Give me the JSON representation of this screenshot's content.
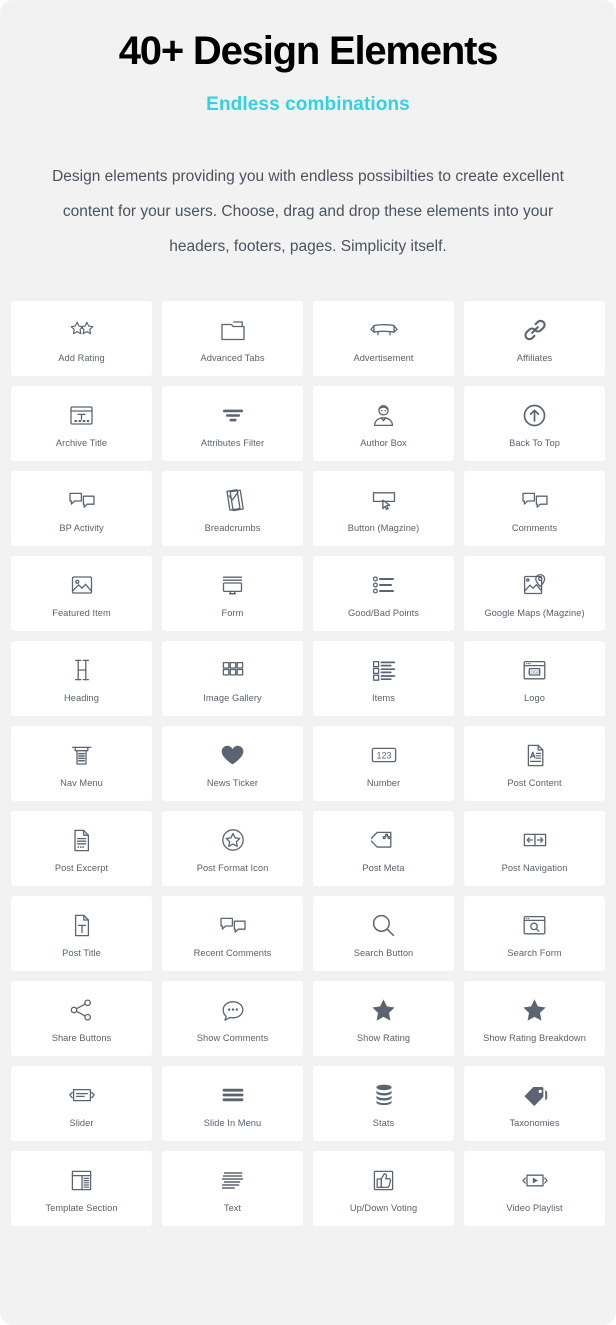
{
  "header": {
    "title": "40+ Design Elements",
    "subtitle": "Endless combinations",
    "subtitle_color": "#2fd3e1",
    "intro": "Design elements providing you with endless possibilties to create excellent content for your users. Choose, drag and drop these elements into your headers, footers, pages. Simplicity itself."
  },
  "colors": {
    "background": "#f2f2f2",
    "card": "#ffffff",
    "icon": "#5b6470",
    "label": "#59626e",
    "accent": "#2fd3e1",
    "title": "#000000"
  },
  "grid": {
    "columns": 4,
    "items": [
      {
        "label": "Add Rating",
        "icon": "two-stars-outline-icon"
      },
      {
        "label": "Advanced Tabs",
        "icon": "folder-tabs-icon"
      },
      {
        "label": "Advertisement",
        "icon": "billboard-banner-icon"
      },
      {
        "label": "Affiliates",
        "icon": "chain-link-icon"
      },
      {
        "label": "Archive Title",
        "icon": "browser-title-t-icon"
      },
      {
        "label": "Attributes Filter",
        "icon": "filter-funnel-bars-icon"
      },
      {
        "label": "Author Box",
        "icon": "author-person-icon"
      },
      {
        "label": "Back To Top",
        "icon": "circle-arrow-up-icon"
      },
      {
        "label": "BP Activity",
        "icon": "two-speech-bubbles-icon"
      },
      {
        "label": "Breadcrumbs",
        "icon": "checkmark-pages-icon"
      },
      {
        "label": "Button (Magzine)",
        "icon": "button-cursor-icon"
      },
      {
        "label": "Comments",
        "icon": "two-speech-bubbles-icon"
      },
      {
        "label": "Featured Item",
        "icon": "image-picture-icon"
      },
      {
        "label": "Form",
        "icon": "form-monitor-icon"
      },
      {
        "label": "Good/Bad Points",
        "icon": "bullet-list-circles-icon"
      },
      {
        "label": "Google Maps (Magzine)",
        "icon": "map-pin-icon"
      },
      {
        "label": "Heading",
        "icon": "letter-h-serif-icon"
      },
      {
        "label": "Image Gallery",
        "icon": "grid-squares-icon"
      },
      {
        "label": "Items",
        "icon": "list-items-icon"
      },
      {
        "label": "Logo",
        "icon": "browser-logo-icon"
      },
      {
        "label": "Nav Menu",
        "icon": "nav-menu-icon"
      },
      {
        "label": "News Ticker",
        "icon": "heart-filled-icon"
      },
      {
        "label": "Number",
        "icon": "number-123-icon"
      },
      {
        "label": "Post Content",
        "icon": "document-a-lines-icon"
      },
      {
        "label": "Post Excerpt",
        "icon": "document-excerpt-icon"
      },
      {
        "label": "Post Format Icon",
        "icon": "circle-star-icon"
      },
      {
        "label": "Post Meta",
        "icon": "price-tag-icon"
      },
      {
        "label": "Post Navigation",
        "icon": "left-right-arrows-box-icon"
      },
      {
        "label": "Post Title",
        "icon": "document-t-icon"
      },
      {
        "label": "Recent Comments",
        "icon": "two-speech-bubbles-icon"
      },
      {
        "label": "Search Button",
        "icon": "magnifier-icon"
      },
      {
        "label": "Search Form",
        "icon": "browser-search-icon"
      },
      {
        "label": "Share Buttons",
        "icon": "share-nodes-icon"
      },
      {
        "label": "Show Comments",
        "icon": "speech-bubble-dots-icon"
      },
      {
        "label": "Show Rating",
        "icon": "star-filled-icon"
      },
      {
        "label": "Show Rating Breakdown",
        "icon": "star-filled-icon"
      },
      {
        "label": "Slider",
        "icon": "slider-arrows-icon"
      },
      {
        "label": "Slide In Menu",
        "icon": "hamburger-bars-icon"
      },
      {
        "label": "Stats",
        "icon": "database-stack-icon"
      },
      {
        "label": "Taxonomies",
        "icon": "tags-filled-icon"
      },
      {
        "label": "Template Section",
        "icon": "template-layout-icon"
      },
      {
        "label": "Text",
        "icon": "text-lines-icon"
      },
      {
        "label": "Up/Down Voting",
        "icon": "thumbs-up-box-icon"
      },
      {
        "label": "Video Playlist",
        "icon": "video-play-arrows-icon"
      }
    ]
  }
}
